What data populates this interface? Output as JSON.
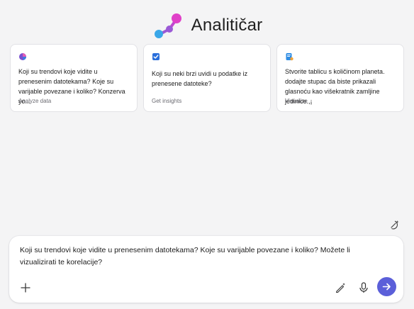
{
  "app": {
    "title": "Analitičar",
    "logo_icon": "analyst-molecule-icon",
    "colors": {
      "accent": "#5b5fd9",
      "logo_pink": "#e040c8",
      "logo_blue": "#3aa7e8",
      "logo_purple": "#9b59d6"
    }
  },
  "cards": [
    {
      "icon": "analyze-chart-icon",
      "prompt": "Koji su trendovi koje vidite u prenesenim datotekama? Koje su varijable povezane i koliko? Konzerva yo...",
      "caption": "Analyze data"
    },
    {
      "icon": "insights-checkbox-icon",
      "prompt": "Koji su neki brzi uvidi u podatke iz prenesene datoteke?",
      "caption": "Get insights"
    },
    {
      "icon": "visualize-document-icon",
      "prompt": "Stvorite tablicu s količinom planeta. dodajte stupac da biste prikazali glasnoću kao višekratnik zamljine jedinice.,¡",
      "caption": "Visualize"
    }
  ],
  "composer": {
    "input_value": "Koji su trendovi koje vidite u prenesenim datotekama? Koje su varijable povezane i koliko? Možete li vizualizirati te korelacije?",
    "add_icon": "plus-icon",
    "prompt_guide_icon": "pen-sparkle-icon",
    "mic_icon": "microphone-icon",
    "send_icon": "arrow-right-icon"
  },
  "reset_icon": "new-chat-sparkle-icon"
}
